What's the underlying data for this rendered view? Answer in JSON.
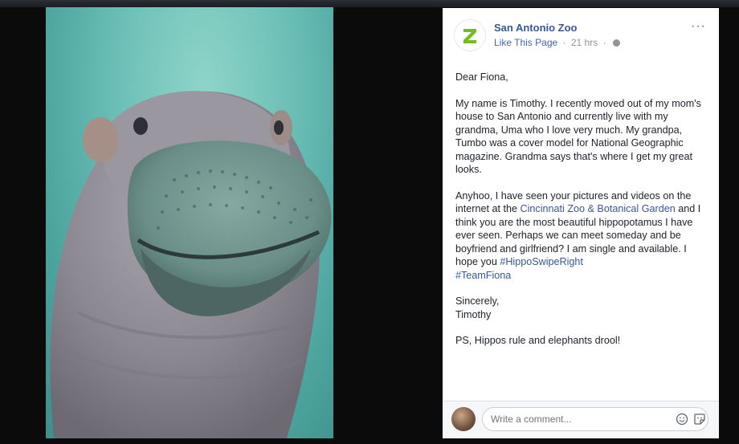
{
  "post": {
    "page_name": "San Antonio Zoo",
    "like_label": "Like This Page",
    "separator": "·",
    "time": "21 hrs",
    "more_label": "···",
    "greeting": "Dear Fiona,",
    "para1": "My name is Timothy. I recently moved out of my mom's house to San Antonio and currently live with my grandma, Uma who I love very much. My grandpa, Tumbo was a cover model for National Geographic magazine. Grandma says that's where I get my great looks.",
    "para2_before": "Anyhoo, I have seen your pictures and videos on the internet at the ",
    "para2_link": "Cincinnati Zoo & Botanical Garden",
    "para2_after": " and I think you are the most beautiful hippopotamus I have ever seen. Perhaps we can meet someday and be boyfriend and girlfriend? I am single and available. I hope you ",
    "hashtag1": "#HippoSwipeRight",
    "hashtag2": "#TeamFiona",
    "closing": "Sincerely,",
    "signature": "Timothy",
    "ps": "PS, Hippos rule and elephants drool!"
  },
  "comment": {
    "placeholder": "Write a comment..."
  },
  "icons": {
    "logo": "zoo-z-logo",
    "visibility": "globe-icon",
    "emoji": "smiley-icon",
    "sticker": "sticker-icon"
  },
  "colors": {
    "link": "#365899",
    "logo_green": "#76bc21",
    "water": "#6fc2b8"
  }
}
